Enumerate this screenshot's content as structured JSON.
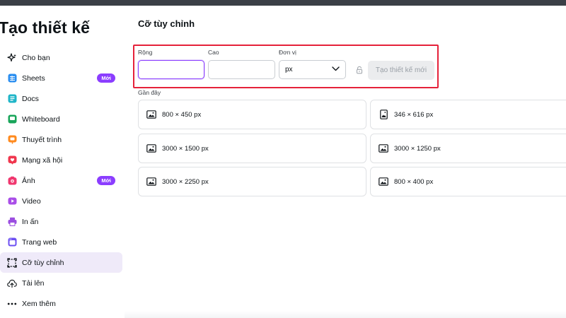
{
  "app": {
    "title": "Tạo thiết kế"
  },
  "sidebar": {
    "items": [
      {
        "label": "Cho bạn",
        "icon": "sparkle-icon",
        "color": "#0d1216"
      },
      {
        "label": "Sheets",
        "icon": "sheets-icon",
        "color": "#2a8ef0",
        "badge": "Mới"
      },
      {
        "label": "Docs",
        "icon": "docs-icon",
        "color": "#1fb5c8"
      },
      {
        "label": "Whiteboard",
        "icon": "whiteboard-icon",
        "color": "#19a55a"
      },
      {
        "label": "Thuyết trình",
        "icon": "presentation-icon",
        "color": "#ff8a1e"
      },
      {
        "label": "Mạng xã hội",
        "icon": "heart-icon",
        "color": "#f0374e"
      },
      {
        "label": "Ảnh",
        "icon": "camera-icon",
        "color": "#f0376f",
        "badge": "Mới"
      },
      {
        "label": "Video",
        "icon": "video-icon",
        "color": "#a94ee8"
      },
      {
        "label": "In ấn",
        "icon": "printer-icon",
        "color": "#9b4ee0"
      },
      {
        "label": "Trang web",
        "icon": "website-icon",
        "color": "#6c4ff2"
      },
      {
        "label": "Cỡ tùy chỉnh",
        "icon": "custom-size-icon",
        "color": "#0d1216",
        "active": true
      },
      {
        "label": "Tải lên",
        "icon": "cloud-upload-icon",
        "color": "#0d1216"
      },
      {
        "label": "Xem thêm",
        "icon": "more-icon",
        "color": "#0d1216"
      }
    ]
  },
  "panel": {
    "title": "Cỡ tùy chỉnh",
    "width_label": "Rộng",
    "width_value": "",
    "height_label": "Cao",
    "height_value": "",
    "unit_label": "Đơn vị",
    "unit_value": "px",
    "create_button": "Tạo thiết kế mới",
    "recent_label": "Gần đây"
  },
  "recent": [
    {
      "label": "800 × 450 px",
      "icon": "landscape-image-icon"
    },
    {
      "label": "346 × 616 px",
      "icon": "portrait-image-icon"
    },
    {
      "label": "3000 × 1500 px",
      "icon": "landscape-image-icon"
    },
    {
      "label": "3000 × 1250 px",
      "icon": "landscape-image-icon"
    },
    {
      "label": "3000 × 2250 px",
      "icon": "landscape-image-icon"
    },
    {
      "label": "800 × 400 px",
      "icon": "landscape-image-icon"
    }
  ],
  "colors": {
    "accent": "#8b3dff",
    "highlight": "#e5213a",
    "active_bg": "#efeaf9"
  }
}
